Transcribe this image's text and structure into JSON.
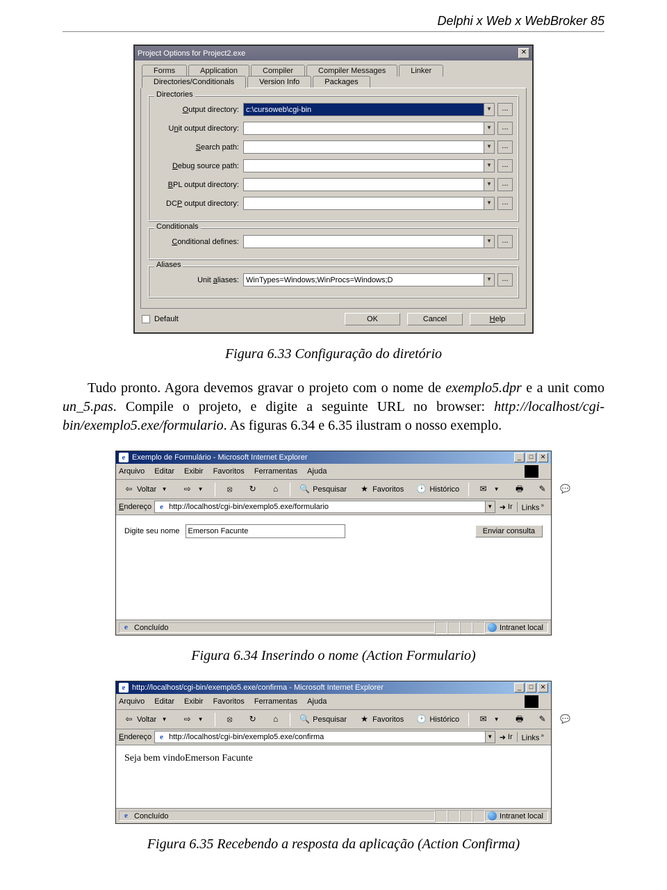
{
  "header": "Delphi x Web x WebBroker   85",
  "dialog": {
    "title": "Project Options for Project2.exe",
    "tabs_back": [
      "Forms",
      "Application",
      "Compiler",
      "Compiler Messages",
      "Linker"
    ],
    "tabs_front": [
      "Directories/Conditionals",
      "Version Info",
      "Packages"
    ],
    "groups": {
      "directories": {
        "legend": "Directories",
        "fields": [
          {
            "label": "Output directory:",
            "value": "c:\\cursoweb\\cgi-bin",
            "hotkey": "O"
          },
          {
            "label": "Unit output directory:",
            "value": "",
            "hotkey": "n"
          },
          {
            "label": "Search path:",
            "value": "",
            "hotkey": "S"
          },
          {
            "label": "Debug source path:",
            "value": "",
            "hotkey": "D"
          },
          {
            "label": "BPL output directory:",
            "value": "",
            "hotkey": "B"
          },
          {
            "label": "DCP output directory:",
            "value": "",
            "hotkey": "P"
          }
        ]
      },
      "conditionals": {
        "legend": "Conditionals",
        "label": "Conditional defines:",
        "value": "",
        "hotkey": "C"
      },
      "aliases": {
        "legend": "Aliases",
        "label": "Unit aliases:",
        "value": "WinTypes=Windows;WinProcs=Windows;D",
        "hotkey": "a"
      }
    },
    "default_label": "Default",
    "ok": "OK",
    "cancel": "Cancel",
    "help": "Help",
    "help_hotkey": "H"
  },
  "caption1": "Figura 6.33 Configuração do diretório",
  "para1": "Tudo pronto. Agora devemos gravar o projeto com o nome de exemplo5.dpr e a unit como un_5.pas. Compile o projeto, e digite a seguinte URL no browser: http://localhost/cgi-bin/exemplo5.exe/formulario. As figuras 6.34 e 6.35 ilustram o nosso exemplo.",
  "ie1": {
    "title": "Exemplo de Formulário - Microsoft Internet Explorer",
    "menu": [
      "Arquivo",
      "Editar",
      "Exibir",
      "Favoritos",
      "Ferramentas",
      "Ajuda"
    ],
    "toolbar": {
      "back": "Voltar",
      "search": "Pesquisar",
      "fav": "Favoritos",
      "hist": "Histórico"
    },
    "addr_label": "Endereço",
    "url": "http://localhost/cgi-bin/exemplo5.exe/formulario",
    "go": "Ir",
    "links": "Links",
    "form_label": "Digite seu nome",
    "form_value": "Emerson Facunte",
    "submit": "Enviar consulta",
    "status": "Concluído",
    "zone": "Intranet local"
  },
  "caption2": "Figura 6.34 Inserindo o nome (Action Formulario)",
  "ie2": {
    "title": "http://localhost/cgi-bin/exemplo5.exe/confirma - Microsoft Internet Explorer",
    "menu": [
      "Arquivo",
      "Editar",
      "Exibir",
      "Favoritos",
      "Ferramentas",
      "Ajuda"
    ],
    "toolbar": {
      "back": "Voltar",
      "search": "Pesquisar",
      "fav": "Favoritos",
      "hist": "Histórico"
    },
    "addr_label": "Endereço",
    "url": "http://localhost/cgi-bin/exemplo5.exe/confirma",
    "go": "Ir",
    "links": "Links",
    "body": "Seja bem vindoEmerson Facunte",
    "status": "Concluído",
    "zone": "Intranet local"
  },
  "caption3": "Figura 6.35 Recebendo a resposta da aplicação (Action Confirma)"
}
